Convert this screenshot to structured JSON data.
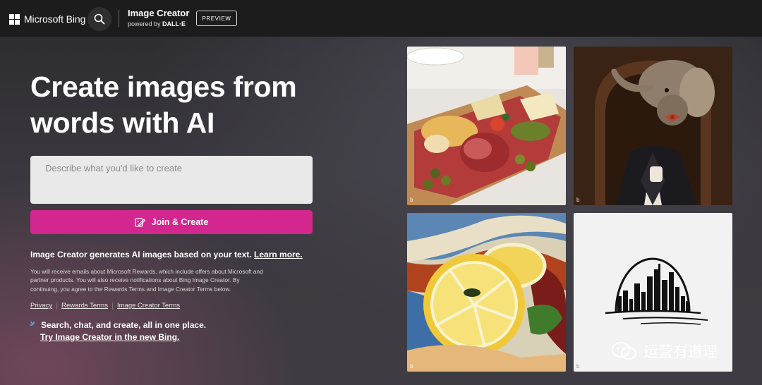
{
  "header": {
    "brand_name": "Microsoft Bing",
    "product_title": "Image Creator",
    "powered_by_prefix": "powered by",
    "powered_by_name": "DALL·E",
    "preview_badge": "PREVIEW",
    "icons": [
      "microsoft-logo-icon",
      "search-icon"
    ]
  },
  "hero": {
    "title": "Create images from words with AI",
    "prompt_placeholder": "Describe what you'd like to create",
    "prompt_value": "",
    "join_button_label": "Join & Create"
  },
  "info": {
    "text": "Image Creator generates AI images based on your text.",
    "learn_more": "Learn more.",
    "fine_print": "You will receive emails about Microsoft Rewards, which include offers about Microsoft and partner products. You will also receive notifications about Bing Image Creator. By continuing, you agree to the Rewards Terms and Image Creator Terms below."
  },
  "links": {
    "privacy": "Privacy",
    "rewards_terms": "Rewards Terms",
    "image_creator_terms": "Image Creator Terms"
  },
  "promo": {
    "line1": "Search, chat, and create, all in one place.",
    "line2": "Try Image Creator in the new Bing."
  },
  "gallery": {
    "tiles": [
      "charcuterie-board-image",
      "elephant-in-suit-image",
      "lemon-abstract-painting-image",
      "city-skyline-logo-image"
    ],
    "corner_mark": "b"
  },
  "watermark": {
    "text": "运营有道理"
  },
  "colors": {
    "accent": "#d4268f",
    "topbar": "#1c1c1c",
    "input_bg": "#e9e9e9"
  }
}
